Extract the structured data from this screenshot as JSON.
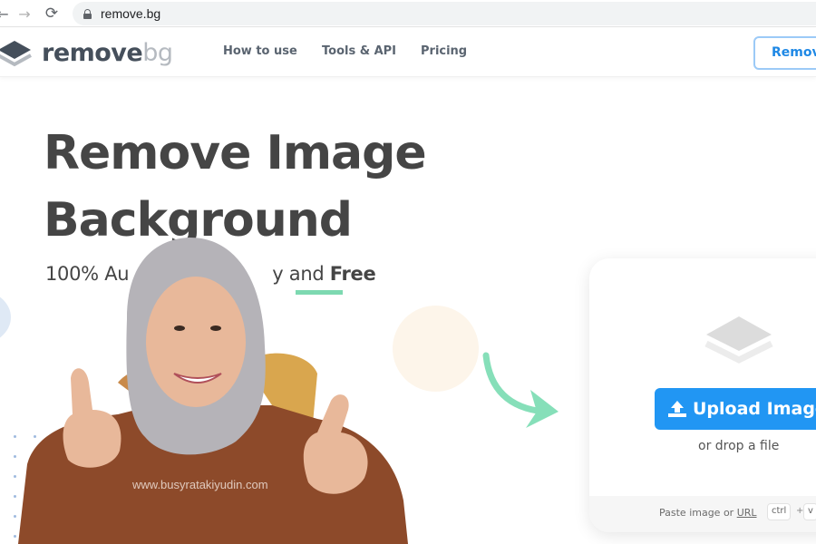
{
  "browser": {
    "url": "remove.bg",
    "back_icon": "←",
    "forward_icon": "→",
    "reload_icon": "⟳"
  },
  "header": {
    "logo_primary": "remove",
    "logo_secondary": "bg",
    "nav": [
      {
        "label": "How to use"
      },
      {
        "label": "Tools & API"
      },
      {
        "label": "Pricing"
      }
    ],
    "cta_label": "Remove"
  },
  "hero": {
    "title_line1": "Remove Image",
    "title_line2": "Background",
    "subtitle_prefix": "100% Au",
    "subtitle_middle": "y and ",
    "subtitle_free": "Free"
  },
  "upload_card": {
    "button_label": "Upload Image",
    "drop_text": "or drop a file",
    "paste_prefix": "Paste image or ",
    "paste_link": "URL",
    "kbd_ctrl": "ctrl",
    "kbd_plus": "+",
    "kbd_v": "v"
  },
  "overlay": {
    "watermark": "www.busyratakiyudin.com"
  },
  "colors": {
    "accent_blue": "#2196f3",
    "accent_green": "#7dd9b1",
    "text_dark": "#454545"
  }
}
